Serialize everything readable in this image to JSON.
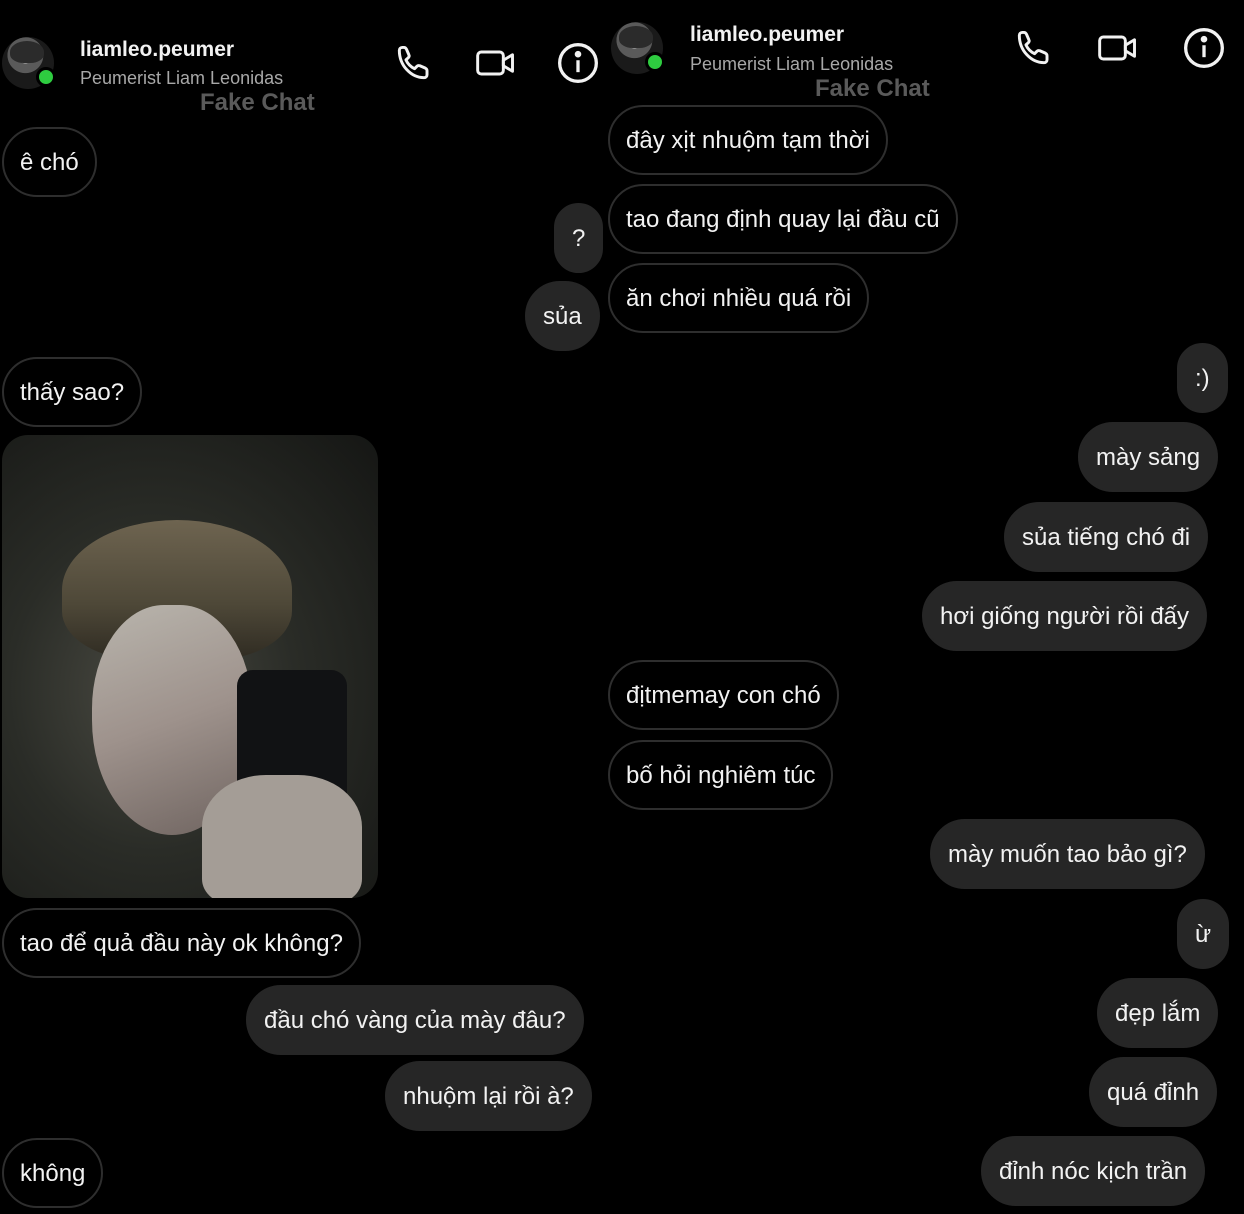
{
  "header": {
    "username": "liamleo.peumer",
    "display_name": "Peumerist Liam Leonidas",
    "watermark": "Fake Chat",
    "icons": [
      "phone-icon",
      "video-icon",
      "info-icon"
    ]
  },
  "colors": {
    "background": "#000000",
    "outgoing_bubble": "#262626",
    "incoming_border": "#2e2e2e",
    "online": "#2ecc40",
    "watermark": "#5a5a5a"
  },
  "left_chat": {
    "messages": [
      {
        "text": "ê chó",
        "side": "in"
      },
      {
        "text": "?",
        "side": "out"
      },
      {
        "text": "sủa",
        "side": "out"
      },
      {
        "text": "thấy sao?",
        "side": "in"
      },
      {
        "text": "tao để quả đầu này ok không?",
        "side": "in"
      },
      {
        "text": "đầu chó vàng của mày đâu?",
        "side": "out"
      },
      {
        "text": "nhuộm lại rồi à?",
        "side": "out"
      },
      {
        "text": "không",
        "side": "in"
      }
    ]
  },
  "right_chat": {
    "messages": [
      {
        "text": "đây xịt nhuộm tạm thời",
        "side": "in"
      },
      {
        "text": "tao đang định quay lại đầu cũ",
        "side": "in"
      },
      {
        "text": "ăn chơi nhiều quá rồi",
        "side": "in"
      },
      {
        "text": ":)",
        "side": "out"
      },
      {
        "text": "mày sảng",
        "side": "out"
      },
      {
        "text": "sủa tiếng chó đi",
        "side": "out"
      },
      {
        "text": "hơi giống người rồi đấy",
        "side": "out"
      },
      {
        "text": "địtmemay con chó",
        "side": "in"
      },
      {
        "text": "bố hỏi nghiêm túc",
        "side": "in"
      },
      {
        "text": "mày muốn tao bảo gì?",
        "side": "out"
      },
      {
        "text": "ừ",
        "side": "out"
      },
      {
        "text": "đẹp lắm",
        "side": "out"
      },
      {
        "text": "quá đỉnh",
        "side": "out"
      },
      {
        "text": "đỉnh nóc kịch trần",
        "side": "out"
      }
    ]
  }
}
